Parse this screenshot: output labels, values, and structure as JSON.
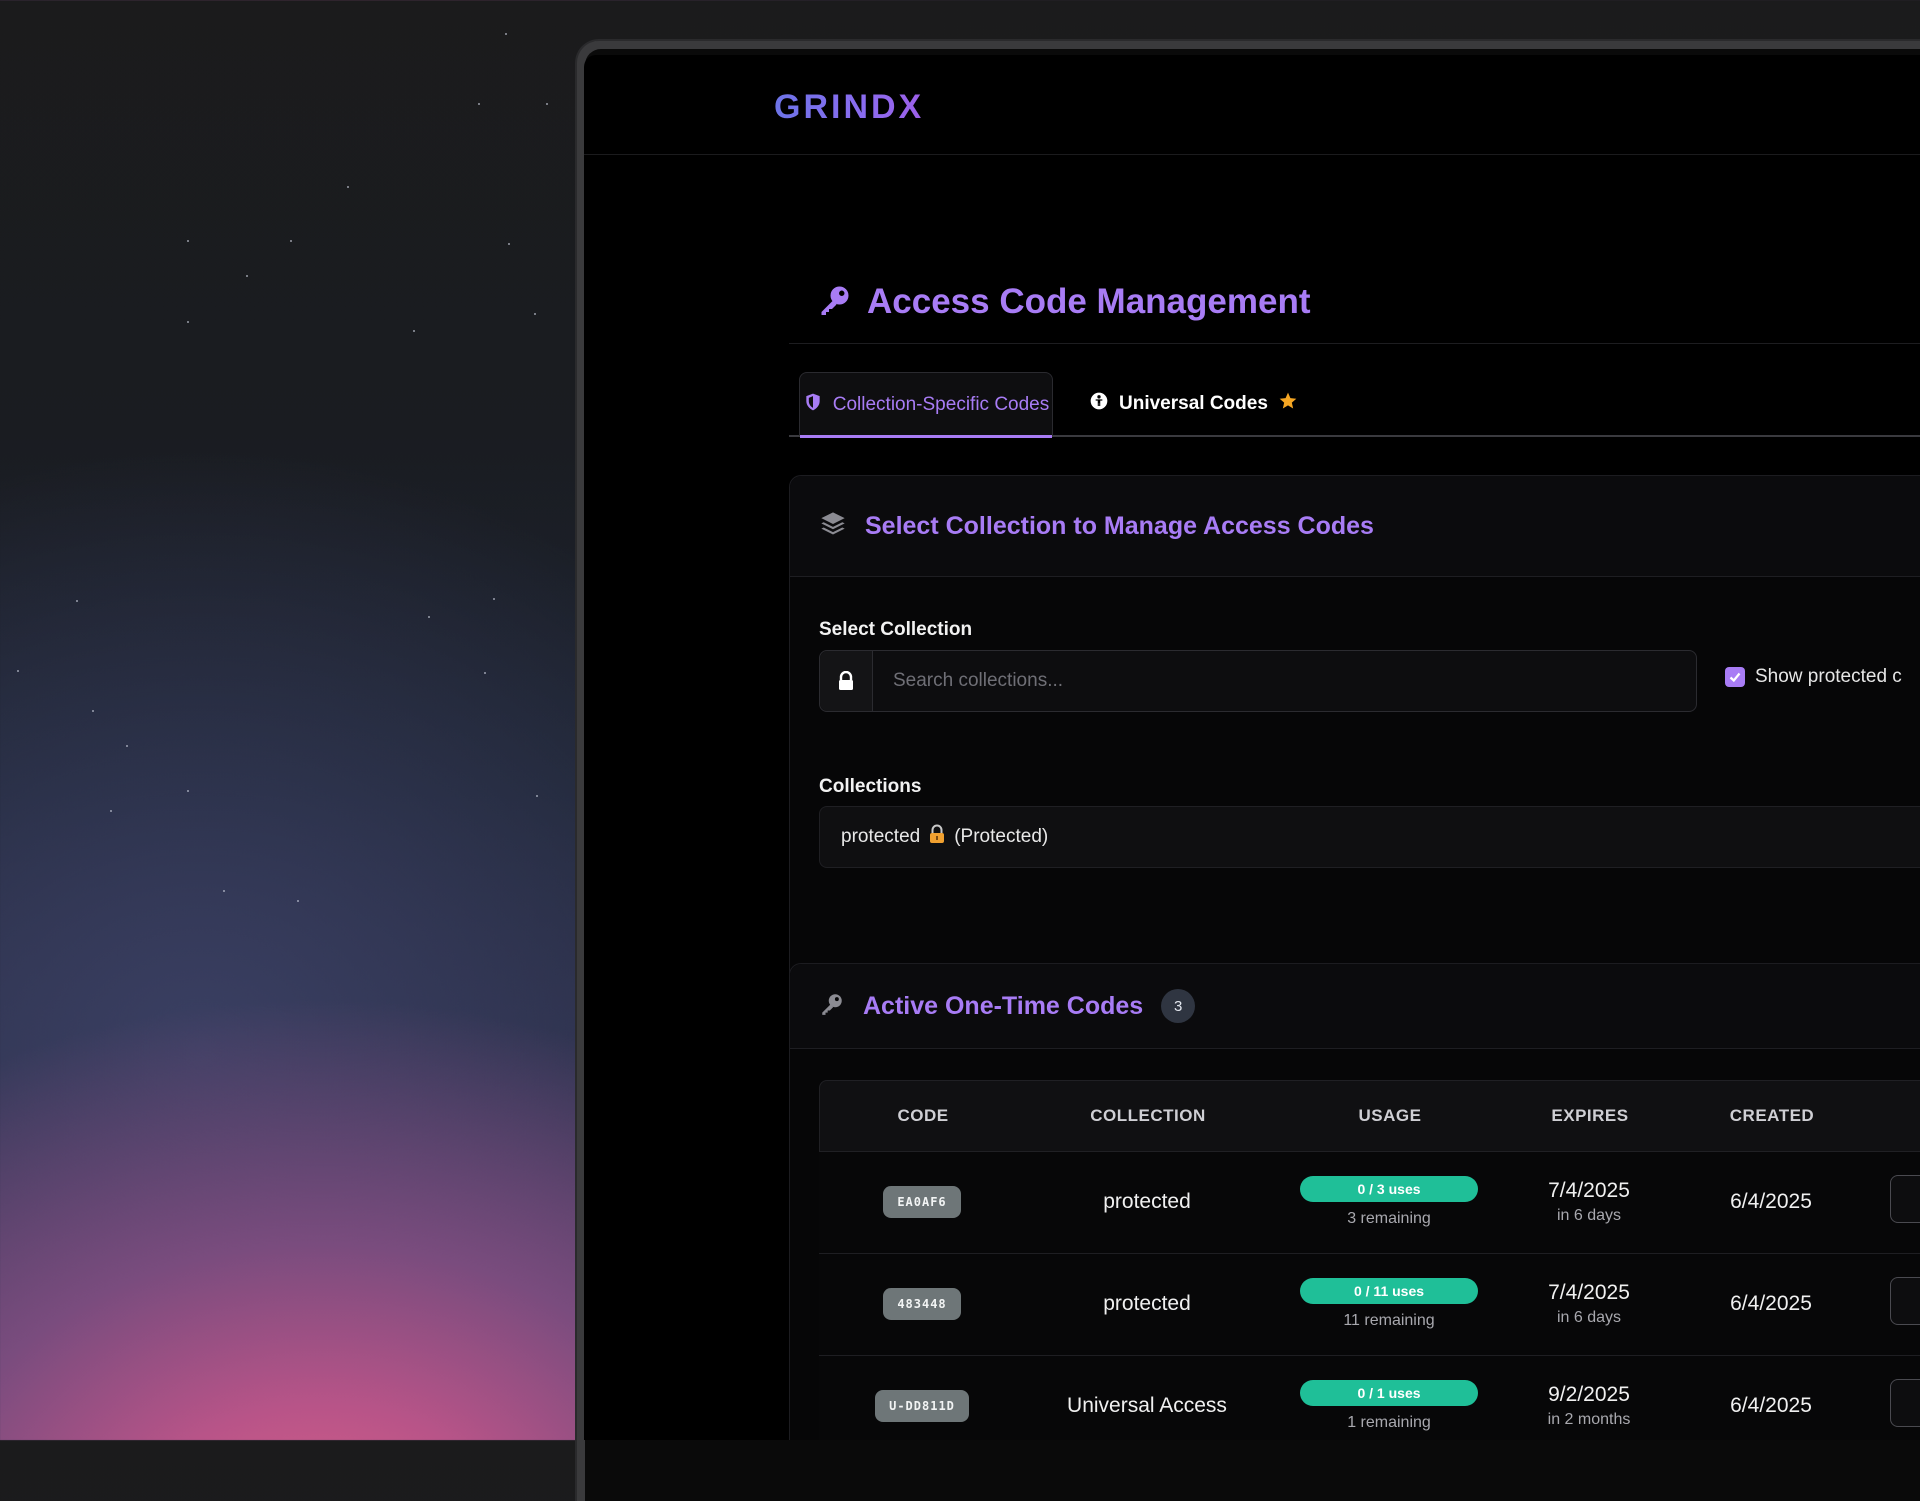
{
  "app": {
    "brand": "GRINDX"
  },
  "page": {
    "title": "Access Code Management",
    "title_icon": "key-icon"
  },
  "tabs": [
    {
      "label": "Collection-Specific Codes",
      "icon": "shield-icon",
      "active": true
    },
    {
      "label": "Universal Codes",
      "icon": "universal-icon",
      "badge_icon": "star-icon",
      "active": false
    }
  ],
  "select_card": {
    "title": "Select Collection to Manage Access Codes",
    "icon": "layers-icon",
    "select_label": "Select Collection",
    "search_placeholder": "Search collections...",
    "show_protected_label": "Show protected c",
    "show_protected_checked": true,
    "collections_label": "Collections",
    "collections": [
      {
        "name": "protected",
        "suffix": "(Protected)",
        "icon": "lock-icon"
      }
    ]
  },
  "codes_card": {
    "title": "Active One-Time Codes",
    "count": "3",
    "columns": [
      "CODE",
      "COLLECTION",
      "USAGE",
      "EXPIRES",
      "CREATED"
    ],
    "rows": [
      {
        "code": "EA0AF6",
        "collection": "protected",
        "usage": "0 / 3 uses",
        "remaining": "3 remaining",
        "expires": "7/4/2025",
        "expires_rel": "in 6 days",
        "created": "6/4/2025"
      },
      {
        "code": "483448",
        "collection": "protected",
        "usage": "0 / 11 uses",
        "remaining": "11 remaining",
        "expires": "7/4/2025",
        "expires_rel": "in 6 days",
        "created": "6/4/2025"
      },
      {
        "code": "U-DD811D",
        "collection": "Universal Access",
        "usage": "0 / 1 uses",
        "remaining": "1 remaining",
        "expires": "9/2/2025",
        "expires_rel": "in 2 months",
        "created": "6/4/2025"
      }
    ]
  },
  "colors": {
    "accent": "#a87cf5",
    "usage_green": "#1fbf98",
    "code_pill": "#6e7678"
  }
}
